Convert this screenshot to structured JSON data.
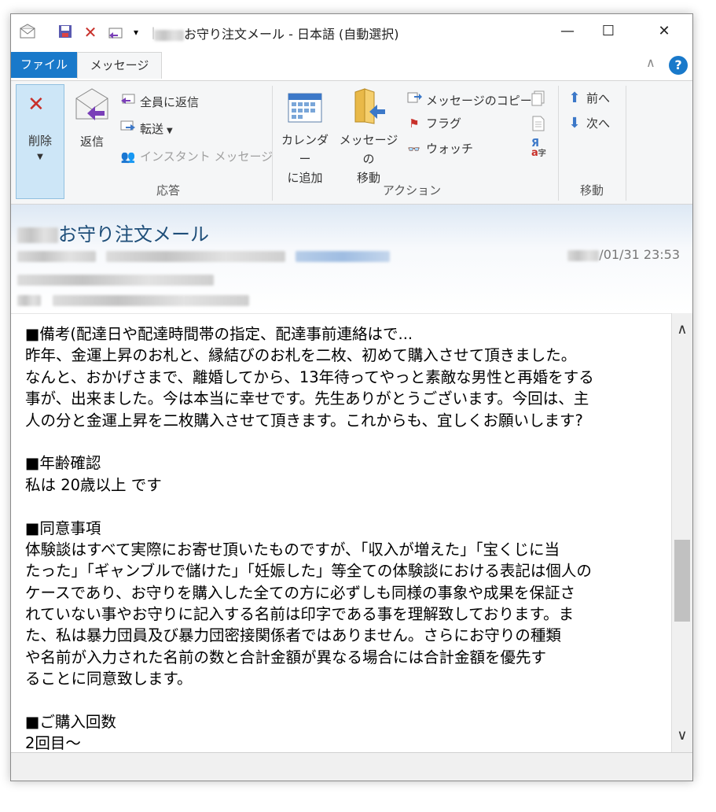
{
  "titlebar": {
    "title": "お守り注文メール - 日本語 (自動選択)",
    "minimize": "—",
    "maximize": "☐",
    "close": "✕"
  },
  "tabs": {
    "file": "ファイル",
    "message": "メッセージ"
  },
  "ribbon": {
    "delete_label": "削除",
    "reply_label": "返信",
    "reply_all_label": "全員に返信",
    "forward_label": "転送",
    "instant_message_label": "インスタント メッセージ",
    "group_respond": "応答",
    "add_calendar_line1": "カレンダー",
    "add_calendar_line2": "に追加",
    "move_message_line1": "メッセージの",
    "move_message_line2": "移動",
    "copy_message_label": "メッセージのコピー",
    "flag_label": "フラグ",
    "watch_label": "ウォッチ",
    "group_action": "アクション",
    "prev_label": "前へ",
    "next_label": "次へ",
    "group_move": "移動"
  },
  "header": {
    "subject": "お守り注文メール",
    "datetime": "/01/31 23:53"
  },
  "body": {
    "lines": [
      "■備考(配達日や配達時間帯の指定、配達事前連絡はで...",
      "昨年、金運上昇のお札と、縁結びのお札を二枚、初めて購入させて頂きました。",
      "なんと、おかげさまで、離婚してから、13年待ってやっと素敵な男性と再婚をする",
      "事が、出来ました。今は本当に幸せです。先生ありがとうございます。今回は、主",
      "人の分と金運上昇を二枚購入させて頂きます。これからも、宜しくお願いします?",
      "",
      "■年齢確認",
      "私は 20歳以上 です",
      "",
      "■同意事項",
      "体験談はすべて実際にお寄せ頂いたものですが、「収入が増えた」「宝くじに当",
      "たった」「ギャンブルで儲けた」「妊娠した」等全ての体験談における表記は個人の",
      "ケースであり、お守りを購入した全ての方に必ずしも同様の事象や成果を保証さ",
      "れていない事やお守りに記入する名前は印字である事を理解致しております。ま",
      "た、私は暴力団員及び暴力団密接関係者ではありません。さらにお守りの種類",
      "や名前が入力された名前の数と合計金額が異なる場合には合計金額を優先す",
      "ることに同意致します。",
      "",
      "■ご購入回数",
      "2回目〜"
    ]
  },
  "scrollbar": {
    "up": "∧",
    "down": "∨"
  }
}
